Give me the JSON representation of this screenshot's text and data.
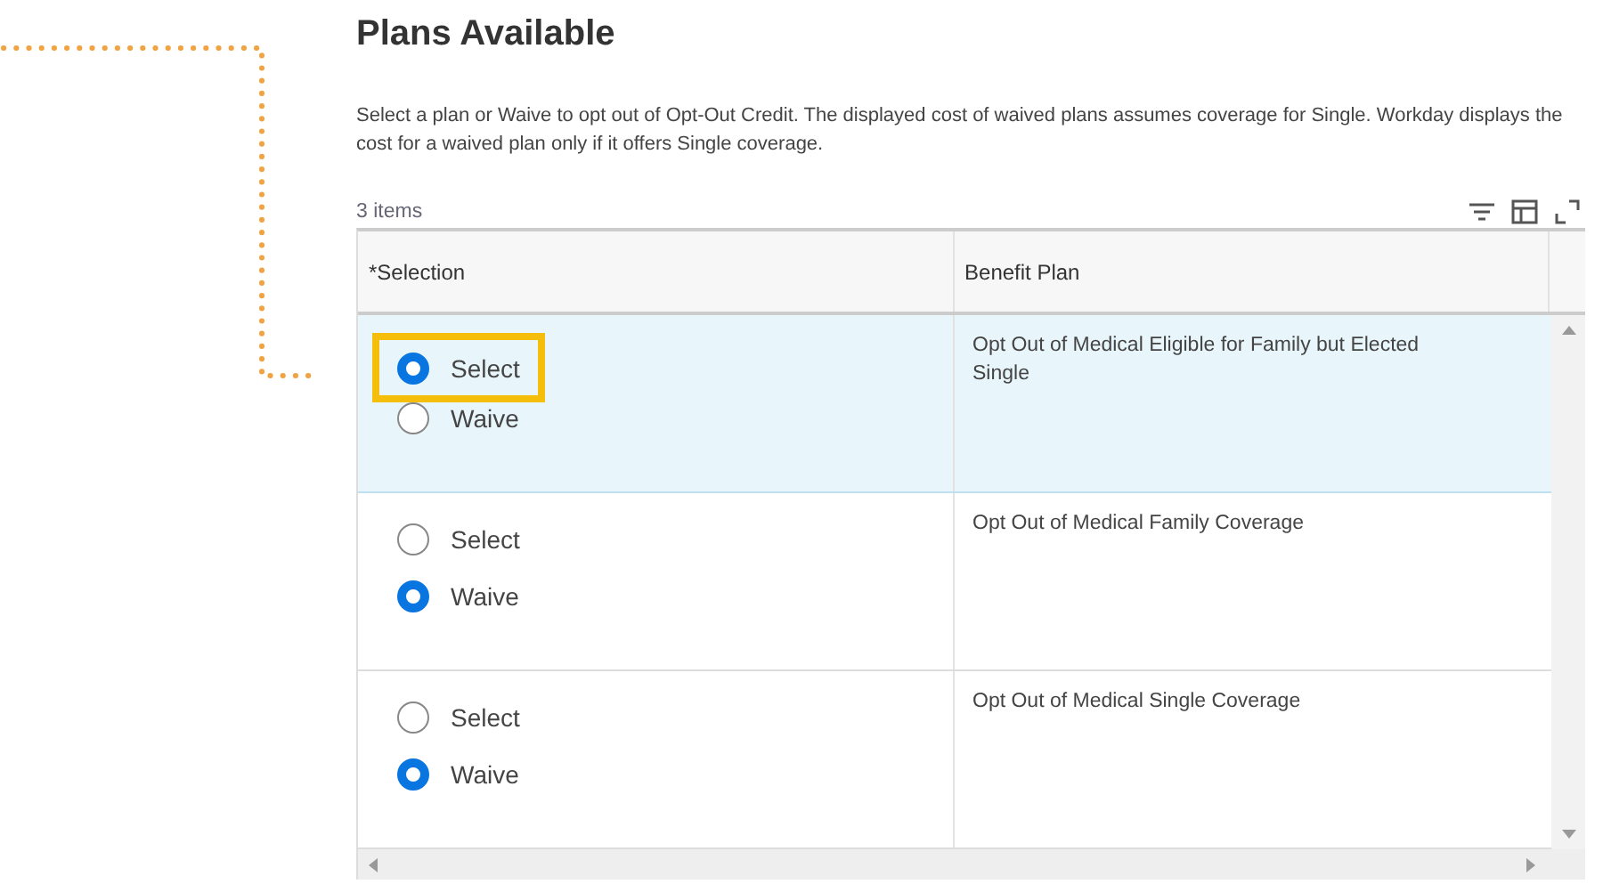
{
  "title": "Plans Available",
  "description": "Select a plan or Waive to opt out of Opt-Out Credit. The displayed cost of waived plans assumes coverage for Single. Workday displays the cost for a waived plan only if it offers Single coverage.",
  "item_count": "3 items",
  "table": {
    "columns": [
      "*Selection",
      "Benefit Plan"
    ],
    "rows": [
      {
        "selected": true,
        "plan": "Opt Out of Medical Eligible for Family but Elected Single",
        "options": [
          {
            "label": "Select",
            "selected": true,
            "highlighted": true
          },
          {
            "label": "Waive",
            "selected": false,
            "highlighted": false
          }
        ]
      },
      {
        "selected": false,
        "plan": "Opt Out of Medical Family Coverage",
        "options": [
          {
            "label": "Select",
            "selected": false,
            "highlighted": false
          },
          {
            "label": "Waive",
            "selected": true,
            "highlighted": false
          }
        ]
      },
      {
        "selected": false,
        "plan": "Opt Out of Medical Single Coverage",
        "options": [
          {
            "label": "Select",
            "selected": false,
            "highlighted": false
          },
          {
            "label": "Waive",
            "selected": true,
            "highlighted": false
          }
        ]
      }
    ]
  }
}
